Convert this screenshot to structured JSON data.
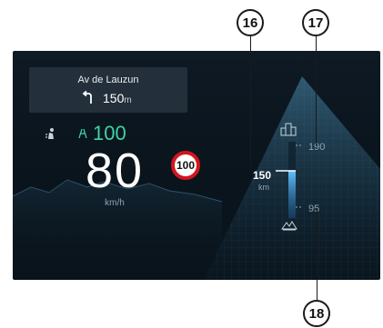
{
  "navigation": {
    "street": "Av de Lauzun",
    "distance": "150",
    "distance_unit": "m",
    "turn_icon": "turn-left-arrow-icon"
  },
  "indicators": {
    "driver_icon": "driver-seat-icon",
    "lane_keeping_icon": "lane-keeping-icon",
    "cruise_speed": "100"
  },
  "speed": {
    "value": "80",
    "unit": "km/h"
  },
  "speed_limit": {
    "value": "100"
  },
  "altitude": {
    "top_value": "190",
    "current_value": "150",
    "current_unit": "km",
    "bottom_value": "95",
    "top_icon": "city-icon",
    "bottom_icon": "terrain-icon"
  },
  "callouts": {
    "c16": "16",
    "c17": "17",
    "c18": "18"
  },
  "colors": {
    "cruise": "#3fd2a5",
    "limit_border": "#d1161e",
    "gauge_fill": "#2a8bd8"
  }
}
